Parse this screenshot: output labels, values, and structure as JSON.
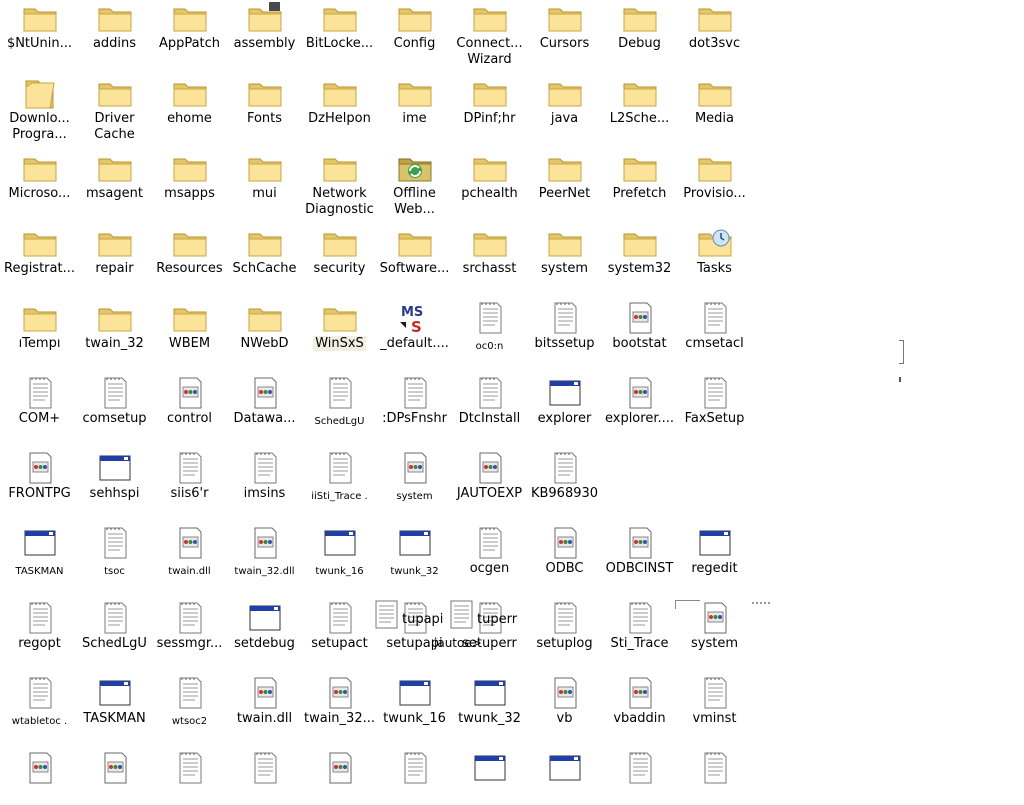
{
  "rows": [
    [
      {
        "label": "$NtUnin...",
        "icon": "folder"
      },
      {
        "label": "addins",
        "icon": "folder"
      },
      {
        "label": "AppPatch",
        "icon": "folder"
      },
      {
        "label": "assembly",
        "icon": "folder-special"
      },
      {
        "label": "BitLocke...",
        "icon": "folder"
      },
      {
        "label": "Config",
        "icon": "folder"
      },
      {
        "label": "Connect... Wizard",
        "icon": "folder"
      },
      {
        "label": "Cursors",
        "icon": "folder"
      },
      {
        "label": "Debug",
        "icon": "folder"
      },
      {
        "label": "dot3svc",
        "icon": "folder"
      }
    ],
    [
      {
        "label": "Downlo... Progra...",
        "icon": "folder-downloaded"
      },
      {
        "label": "Driver Cache",
        "icon": "folder"
      },
      {
        "label": "ehome",
        "icon": "folder"
      },
      {
        "label": "Fonts",
        "icon": "folder"
      },
      {
        "label": "DzHelpon",
        "icon": "folder"
      },
      {
        "label": "ime",
        "icon": "folder"
      },
      {
        "label": "DPinf;hr",
        "icon": "folder"
      },
      {
        "label": "java",
        "icon": "folder"
      },
      {
        "label": "L2Sche...",
        "icon": "folder"
      },
      {
        "label": "Media",
        "icon": "folder"
      }
    ],
    [
      {
        "label": "Microso...",
        "icon": "folder"
      },
      {
        "label": "msagent",
        "icon": "folder"
      },
      {
        "label": "msapps",
        "icon": "folder"
      },
      {
        "label": "mui",
        "icon": "folder"
      },
      {
        "label": "Network Diagnostic",
        "icon": "folder"
      },
      {
        "label": "Offline Web...",
        "icon": "folder-offline"
      },
      {
        "label": "pchealth",
        "icon": "folder"
      },
      {
        "label": "PeerNet",
        "icon": "folder"
      },
      {
        "label": "Prefetch",
        "icon": "folder"
      },
      {
        "label": "Provisio...",
        "icon": "folder"
      }
    ],
    [
      {
        "label": "Registrat...",
        "icon": "folder"
      },
      {
        "label": "repair",
        "icon": "folder"
      },
      {
        "label": "Resources",
        "icon": "folder"
      },
      {
        "label": "SchCache",
        "icon": "folder"
      },
      {
        "label": "security",
        "icon": "folder"
      },
      {
        "label": "Software...",
        "icon": "folder"
      },
      {
        "label": "srchasst",
        "icon": "folder"
      },
      {
        "label": "system",
        "icon": "folder"
      },
      {
        "label": "system32",
        "icon": "folder"
      },
      {
        "label": "Tasks",
        "icon": "folder-tasks"
      }
    ],
    [
      {
        "label": "ıTempı",
        "icon": "folder"
      },
      {
        "label": "twain_32",
        "icon": "folder"
      },
      {
        "label": "WBEM",
        "icon": "folder"
      },
      {
        "label": "NWebD",
        "icon": "folder"
      },
      {
        "label": "WinSxS",
        "icon": "folder",
        "highlight": true
      },
      {
        "label": "_default....",
        "icon": "ms-logo"
      },
      {
        "label": "oc0:n",
        "icon": "text-file",
        "small": true
      },
      {
        "label": "bitssetup",
        "icon": "text-file"
      },
      {
        "label": "bootstat",
        "icon": "ini-file"
      },
      {
        "label": "cmsetacl",
        "icon": "text-file"
      }
    ],
    [
      {
        "label": "COM+",
        "icon": "text-file"
      },
      {
        "label": "comsetup",
        "icon": "text-file"
      },
      {
        "label": "control",
        "icon": "ini-file"
      },
      {
        "label": "Datawa...",
        "icon": "ini-file"
      },
      {
        "label": "SchedLgU",
        "icon": "text-file",
        "small": true
      },
      {
        "label": ":DPsFnshr",
        "icon": "text-file"
      },
      {
        "label": "DtcInstall",
        "icon": "text-file"
      },
      {
        "label": "explorer",
        "icon": "app-window"
      },
      {
        "label": "explorer....",
        "icon": "ini-file"
      },
      {
        "label": "FaxSetup",
        "icon": "text-file"
      }
    ],
    [
      {
        "label": "FRONTPG",
        "icon": "ini-file"
      },
      {
        "label": "sehhspi",
        "icon": "app-window"
      },
      {
        "label": "siis6'r",
        "icon": "text-file"
      },
      {
        "label": "imsins",
        "icon": "text-file"
      },
      {
        "label": "iiSti_Trace .",
        "icon": "text-file",
        "small": true
      },
      {
        "label": "system",
        "icon": "ini-file",
        "small": true
      },
      {
        "label": "JAUTOEXP",
        "icon": "ini-file"
      },
      {
        "label": "KB968930",
        "icon": "text-file"
      }
    ],
    [
      {
        "label": "TASKMAN",
        "icon": "app-window",
        "small": true
      },
      {
        "label": "tsoc",
        "icon": "text-file",
        "small": true
      },
      {
        "label": "twain.dll",
        "icon": "ini-file",
        "small": true
      },
      {
        "label": "twain_32.dll",
        "icon": "ini-file",
        "small": true
      },
      {
        "label": "twunk_16",
        "icon": "app-window",
        "small": true
      },
      {
        "label": "twunk_32",
        "icon": "app-window",
        "small": true
      },
      {
        "label": "ocgen",
        "icon": "text-file"
      },
      {
        "label": "ODBC",
        "icon": "ini-file"
      },
      {
        "label": "ODBCINST",
        "icon": "ini-file"
      },
      {
        "label": "regedit",
        "icon": "app-window"
      }
    ],
    [
      {
        "label": "regopt",
        "icon": "text-file"
      },
      {
        "label": "SchedLgU",
        "icon": "text-file"
      },
      {
        "label": "sessmgr...",
        "icon": "text-file"
      },
      {
        "label": "setdebug",
        "icon": "app-window"
      },
      {
        "label": "setupact",
        "icon": "text-file"
      },
      {
        "label": "setupapi",
        "icon": "text-file"
      },
      {
        "label": "setuperr",
        "icon": "text-file"
      },
      {
        "label": "setuplog",
        "icon": "text-file"
      },
      {
        "label": "Sti_Trace",
        "icon": "text-file"
      },
      {
        "label": "system",
        "icon": "ini-file"
      }
    ],
    [
      {
        "label": "wtabletoc .",
        "icon": "text-file",
        "small": true
      },
      {
        "label": "TASKMAN",
        "icon": "app-window"
      },
      {
        "label": "wtsoc2",
        "icon": "text-file",
        "small": true
      },
      {
        "label": "twain.dll",
        "icon": "ini-file"
      },
      {
        "label": "twain_32...",
        "icon": "ini-file"
      },
      {
        "label": "twunk_16",
        "icon": "app-window"
      },
      {
        "label": "twunk_32",
        "icon": "app-window"
      },
      {
        "label": "vb",
        "icon": "ini-file"
      },
      {
        "label": "vbaddin",
        "icon": "ini-file"
      },
      {
        "label": "vminst",
        "icon": "text-file"
      }
    ],
    [
      {
        "label": "",
        "icon": "ini-file"
      },
      {
        "label": "",
        "icon": "ini-file"
      },
      {
        "label": "",
        "icon": "text-file"
      },
      {
        "label": "",
        "icon": "text-file"
      },
      {
        "label": "",
        "icon": "ini-file"
      },
      {
        "label": "",
        "icon": "text-file"
      },
      {
        "label": "",
        "icon": "app-window"
      },
      {
        "label": "",
        "icon": "app-window"
      },
      {
        "label": "",
        "icon": "text-file"
      },
      {
        "label": "",
        "icon": "text-file"
      }
    ]
  ],
  "ghosts": [
    {
      "label": "tupapi",
      "icon": "text-file"
    },
    {
      "label": "tuperr",
      "icon": "text-file"
    },
    {
      "label": "jautoe>",
      "icon": "none"
    }
  ]
}
